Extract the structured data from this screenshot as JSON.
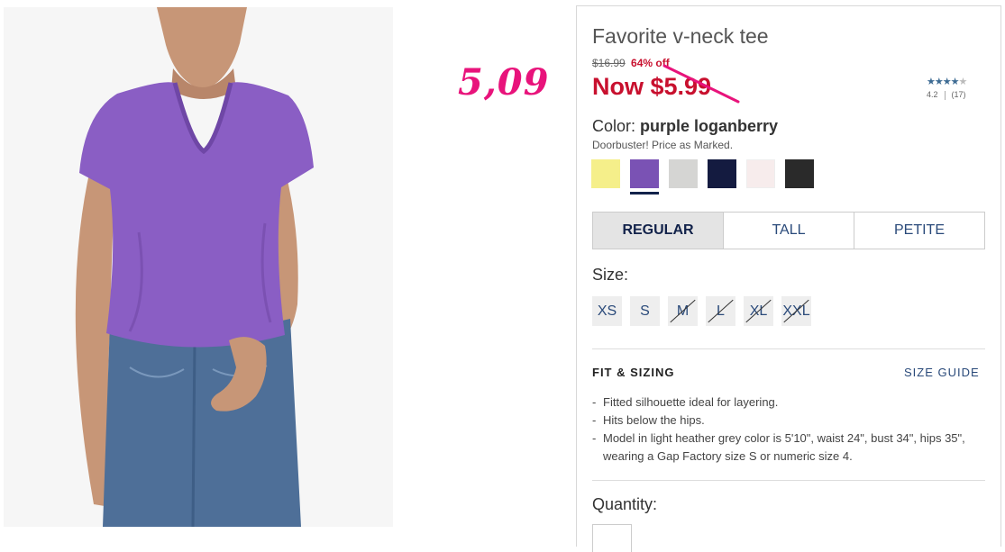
{
  "product": {
    "title": "Favorite v-neck tee",
    "original_price": "$16.99",
    "discount": "64% off",
    "now_price": "Now $5.99",
    "rating": {
      "stars": "★★★★",
      "empty_star": "★",
      "score": "4.2",
      "count": "(17)",
      "value": 4.2
    },
    "color_prefix": "Color:",
    "color_name": "purple loganberry",
    "promo": "Doorbuster! Price as Marked.",
    "swatches": [
      {
        "name": "yellow",
        "color": "#f5ef8a"
      },
      {
        "name": "purple loganberry",
        "color": "#7a52b4",
        "selected": true
      },
      {
        "name": "light heather grey",
        "color": "#d5d5d3"
      },
      {
        "name": "navy",
        "color": "#141b40"
      },
      {
        "name": "pale pink",
        "color": "#f7ecec"
      },
      {
        "name": "black",
        "color": "#2a2a2a"
      }
    ],
    "fits": [
      "REGULAR",
      "TALL",
      "PETITE"
    ],
    "size_label": "Size:",
    "sizes": [
      {
        "label": "XS",
        "available": true
      },
      {
        "label": "S",
        "available": true
      },
      {
        "label": "M",
        "available": false
      },
      {
        "label": "L",
        "available": false
      },
      {
        "label": "XL",
        "available": false
      },
      {
        "label": "XXL",
        "available": false
      }
    ],
    "fit_sizing_title": "FIT & SIZING",
    "size_guide": "SIZE GUIDE",
    "details": [
      "Fitted silhouette ideal for layering.",
      "Hits below the hips.",
      "Model in light heather grey color is 5'10\", waist 24\", bust 34\", hips 35\", wearing a Gap Factory size S or numeric size 4."
    ],
    "quantity_label": "Quantity:"
  },
  "annotation": {
    "handwritten_price": "5,09"
  },
  "colors": {
    "sale_red": "#c8102e",
    "annotation_pink": "#e8137b",
    "link_blue": "#2a4a7a"
  }
}
